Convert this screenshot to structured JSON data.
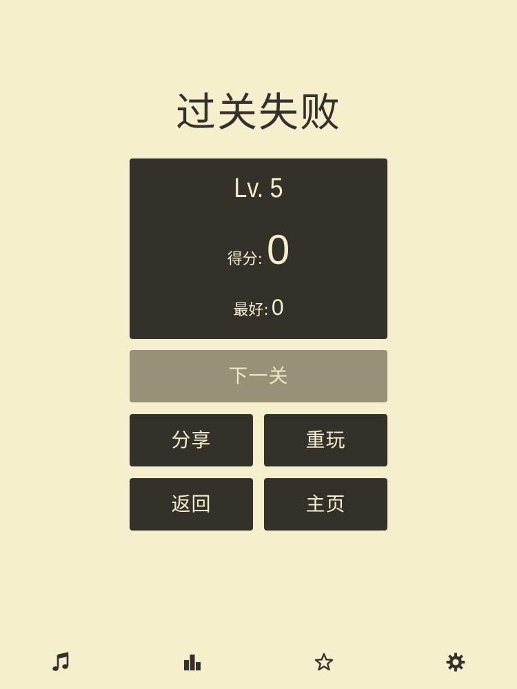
{
  "screen": {
    "title": "过关失败"
  },
  "result": {
    "level": "Lv. 5",
    "score_label": "得分:",
    "score_value": "0",
    "best_label": "最好:",
    "best_value": "0"
  },
  "buttons": {
    "next_level": "下一关",
    "share": "分享",
    "replay": "重玩",
    "back": "返回",
    "home": "主页"
  },
  "bottom_bar": {
    "icons": [
      "music-icon",
      "stats-icon",
      "star-icon",
      "settings-icon"
    ]
  },
  "colors": {
    "background": "#f5efce",
    "panel": "#34312a",
    "disabled_button": "#969177",
    "text_light": "#f5efce"
  }
}
